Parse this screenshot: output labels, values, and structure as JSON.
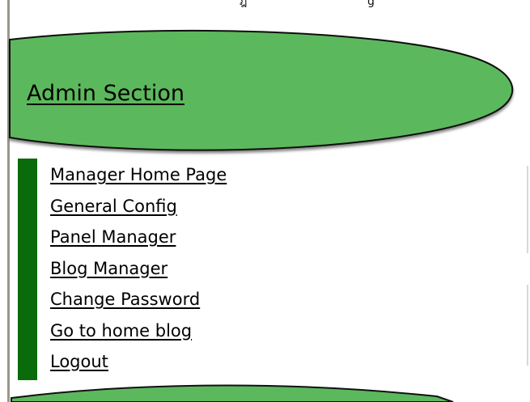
{
  "colors": {
    "ellipse_fill": "#5cb85c",
    "ellipse_stroke": "#111111",
    "menu_bar": "#0a6b0a",
    "left_rule": "#9a9888"
  },
  "admin": {
    "title": "Admin Section"
  },
  "menu": {
    "items": [
      {
        "label": "Manager Home Page"
      },
      {
        "label": "General Config"
      },
      {
        "label": "Panel Manager"
      },
      {
        "label": "Blog Manager"
      },
      {
        "label": "Change Password"
      },
      {
        "label": "Go to home blog"
      },
      {
        "label": "Logout"
      }
    ]
  }
}
